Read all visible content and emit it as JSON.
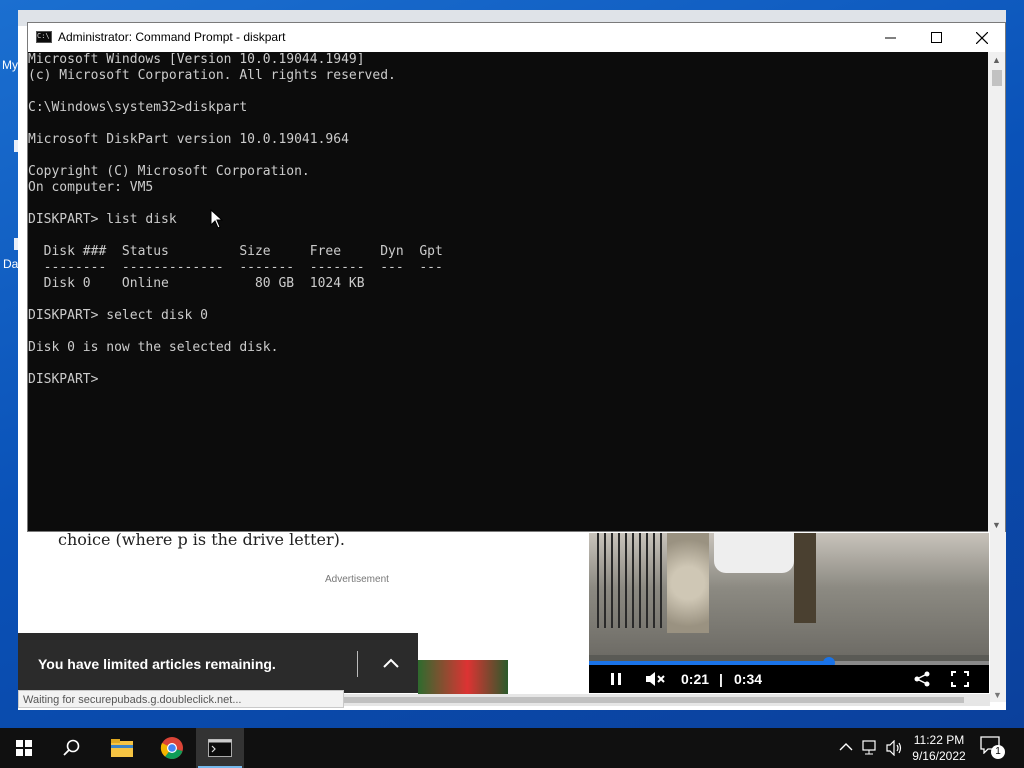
{
  "desktop": {
    "icon_labels": [
      "My",
      "Da"
    ]
  },
  "browser": {
    "article_text": "choice (where p is the drive letter).",
    "ad_label": "Advertisement",
    "paywall_text": "You have limited articles remaining.",
    "status_text": "Waiting for securepubads.g.doubleclick.net...",
    "video": {
      "current_time": "0:21",
      "separator": "|",
      "duration": "0:34",
      "progress": 0.6
    }
  },
  "cmd": {
    "title": "Administrator: Command Prompt - diskpart",
    "icon_text": "C:\\",
    "lines": [
      "Microsoft Windows [Version 10.0.19044.1949]",
      "(c) Microsoft Corporation. All rights reserved.",
      "",
      "C:\\Windows\\system32>diskpart",
      "",
      "Microsoft DiskPart version 10.0.19041.964",
      "",
      "Copyright (C) Microsoft Corporation.",
      "On computer: VM5",
      "",
      "DISKPART> list disk",
      "",
      "  Disk ###  Status         Size     Free     Dyn  Gpt",
      "  --------  -------------  -------  -------  ---  ---",
      "  Disk 0    Online           80 GB  1024 KB",
      "",
      "DISKPART> select disk 0",
      "",
      "Disk 0 is now the selected disk.",
      "",
      "DISKPART>"
    ]
  },
  "taskbar": {
    "time": "11:22 PM",
    "date": "9/16/2022",
    "notification_count": "1",
    "apps": [
      "start-icon",
      "search-icon",
      "file-explorer-icon",
      "chrome-icon",
      "command-prompt-icon"
    ]
  },
  "colors": {
    "console_bg": "#0c0c0c",
    "console_fg": "#cccccc",
    "accent": "#1a73e8",
    "taskbar": "#101010"
  }
}
